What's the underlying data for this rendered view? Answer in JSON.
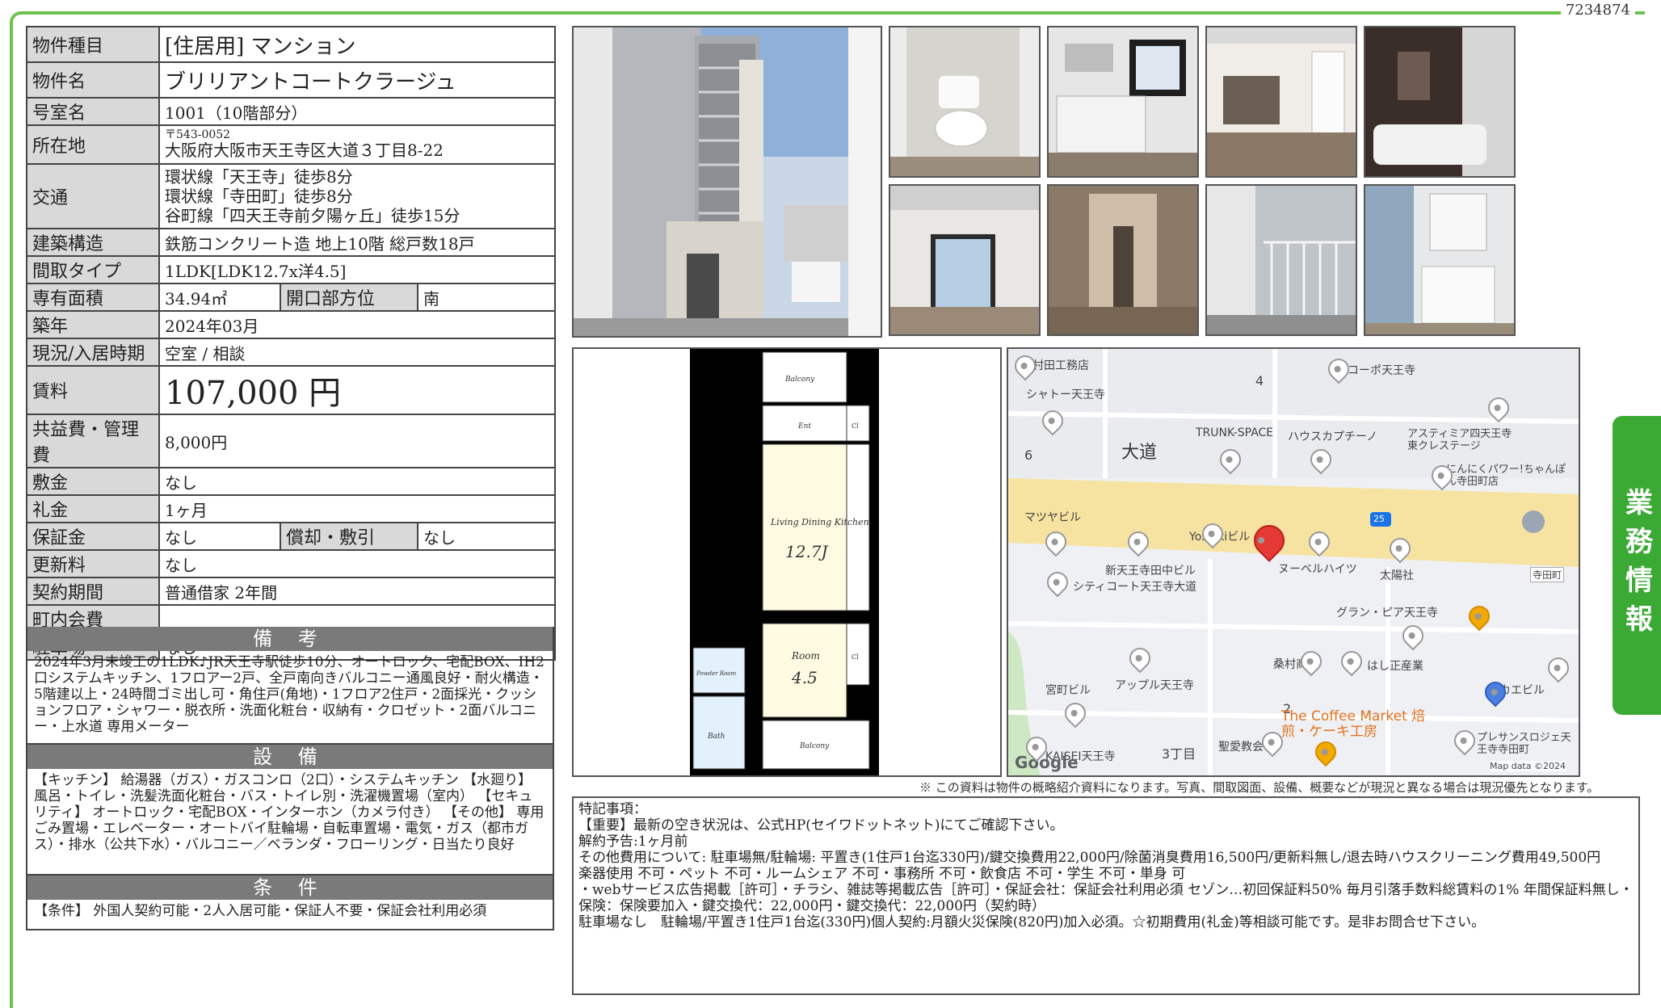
{
  "doc_id": "7234874",
  "side_tab": "業務情報",
  "spec": {
    "rows": [
      {
        "label": "物件種目",
        "value": "[住居用]  マンション"
      },
      {
        "label": "物件名",
        "value": "ブリリアントコートクラージュ"
      },
      {
        "label": "号室名",
        "value": "1001（10階部分）"
      },
      {
        "label": "所在地",
        "postal": "〒543-0052",
        "value": "大阪府大阪市天王寺区大道３丁目8-22"
      },
      {
        "label": "交通",
        "lines": [
          "環状線「天王寺」徒歩8分",
          "環状線「寺田町」徒歩8分",
          "谷町線「四天王寺前夕陽ヶ丘」徒歩15分"
        ]
      },
      {
        "label": "建築構造",
        "value": "鉄筋コンクリート造  地上10階  総戸数18戸"
      },
      {
        "label": "間取タイプ",
        "value": "1LDK[LDK12.7x洋4.5]"
      },
      {
        "label": "専有面積",
        "value": "34.94㎡",
        "label2": "開口部方位",
        "value2": "南"
      },
      {
        "label": "築年",
        "value": "2024年03月"
      },
      {
        "label": "現況/入居時期",
        "value": "空室  /  相談"
      },
      {
        "label": "賃料",
        "value": "107,000 円"
      },
      {
        "label": "共益費・管理費",
        "value": "8,000円"
      },
      {
        "label": "敷金",
        "value": "なし"
      },
      {
        "label": "礼金",
        "value": "1ヶ月"
      },
      {
        "label": "保証金",
        "value": "なし",
        "label2": "償却・敷引",
        "value2": "なし"
      },
      {
        "label": "更新料",
        "value": "なし"
      },
      {
        "label": "契約期間",
        "value": "普通借家  2年間"
      },
      {
        "label": "町内会費",
        "value": ""
      },
      {
        "label": "駐車場",
        "value": "なし"
      }
    ]
  },
  "remarks": {
    "heading": "備 考",
    "text": "2024年3月末竣工の1LDK♪JR天王寺駅徒歩10分、オートロック、宅配BOX、IH2口システムキッチン、1フロアー2戸、全戸南向きバルコニー通風良好・耐火構造・5階建以上・24時間ゴミ出し可・角住戸(角地)・1フロア2住戸・2面採光・クッションフロア・シャワー・脱衣所・洗面化粧台・収納有・クロゼット・2面バルコニー・上水道 専用メーター"
  },
  "facilities": {
    "heading": "設 備",
    "text": "【キッチン】 給湯器（ガス）・ガスコンロ（2口）・システムキッチン 【水廻り】 風呂・トイレ・洗髪洗面化粧台・バス・トイレ別・洗濯機置場（室内） 【セキュリティ】 オートロック・宅配BOX・インターホン（カメラ付き） 【その他】 専用ごみ置場・エレベーター・オートバイ駐輪場・自転車置場・電気・ガス（都市ガス）・排水（公共下水）・バルコニー／ベランダ・フローリング・日当たり良好"
  },
  "conditions": {
    "heading": "条 件",
    "text": "【条件】 外国人契約可能・2人入居可能・保証人不要・保証会社利用必須"
  },
  "floorplan": {
    "balcony": "Balcony",
    "ent": "Ent",
    "cl": "Cl",
    "ldk_label": "Living Dining Kitchen",
    "ldk_size": "12.7J",
    "room_label": "Room",
    "room_size": "4.5",
    "bath": "Bath",
    "powder": "Powder Room"
  },
  "map": {
    "area_name": "大道",
    "block_4": "4",
    "block_6": "6",
    "block_2": "2",
    "block_3": "3丁目",
    "route": "25",
    "labels": [
      "村田工務店",
      "コーポ天王寺",
      "シャトー天王寺",
      "TRUNK-SPACE",
      "ハウスカプチーノ",
      "アスティミア四天王寺東クレステージ",
      "にんにくパワー!ちゃんぽん寺田町店",
      "マツヤビル",
      "Yoshikiビル",
      "新天王寺田中ビル",
      "ヌーベルハイツ",
      "シティコート天王寺大道",
      "太陽社",
      "寺田町",
      "グラン・ピア天王寺",
      "桑村商店",
      "はし正産業",
      "アップル天王寺",
      "宮町ビル",
      "ナカエビル",
      "聖愛教会",
      "KAISEI天王寺",
      "プレサンスロジェ天王寺寺田町"
    ],
    "coffee": "The Coffee Market 焙煎・ケーキ工房",
    "google": "Google",
    "credit": "Map data ©2024"
  },
  "disclaimer": "※ この資料は物件の概略紹介資料になります。写真、間取図面、設備、概要などが現況と異なる場合は現況優先となります。",
  "notes": {
    "lines": [
      "特記事項：",
      "【重要】最新の空き状況は、公式HP(セイワドットネット)にてご確認下さい。",
      "解約予告:1ヶ月前",
      "その他費用について: 駐車場無/駐輪場: 平置き(1住戸1台迄330円)/鍵交換費用22,000円/除菌消臭費用16,500円/更新料無し/退去時ハウスクリーニング費用49,500円",
      "楽器使用 不可・ペット 不可・ルームシェア 不可・事務所 不可・飲食店 不可・学生 不可・単身 可",
      "・webサービス広告掲載［許可］・チラシ、雑誌等掲載広告［許可］・保証会社：保証会社利用必須 セゾン…初回保証料50% 毎月引落手数料総賃料の1% 年間保証料無し・保険：保険要加入・鍵交換代：22,000円・鍵交換代：22,000円（契約時）",
      "駐車場なし　駐輪場/平置き1住戸1台迄(330円)個人契約:月額火災保険(820円)加入必須。☆初期費用(礼金)等相談可能です。是非お問合せ下さい。"
    ]
  },
  "colors": {
    "green_frame": "#6cc24a",
    "tab_green": "#3aaa35",
    "label_gray": "#d9d9d9",
    "header_gray": "#7a7a7a",
    "map_pin": "#e53935",
    "map_road": "#f6e3a1"
  }
}
